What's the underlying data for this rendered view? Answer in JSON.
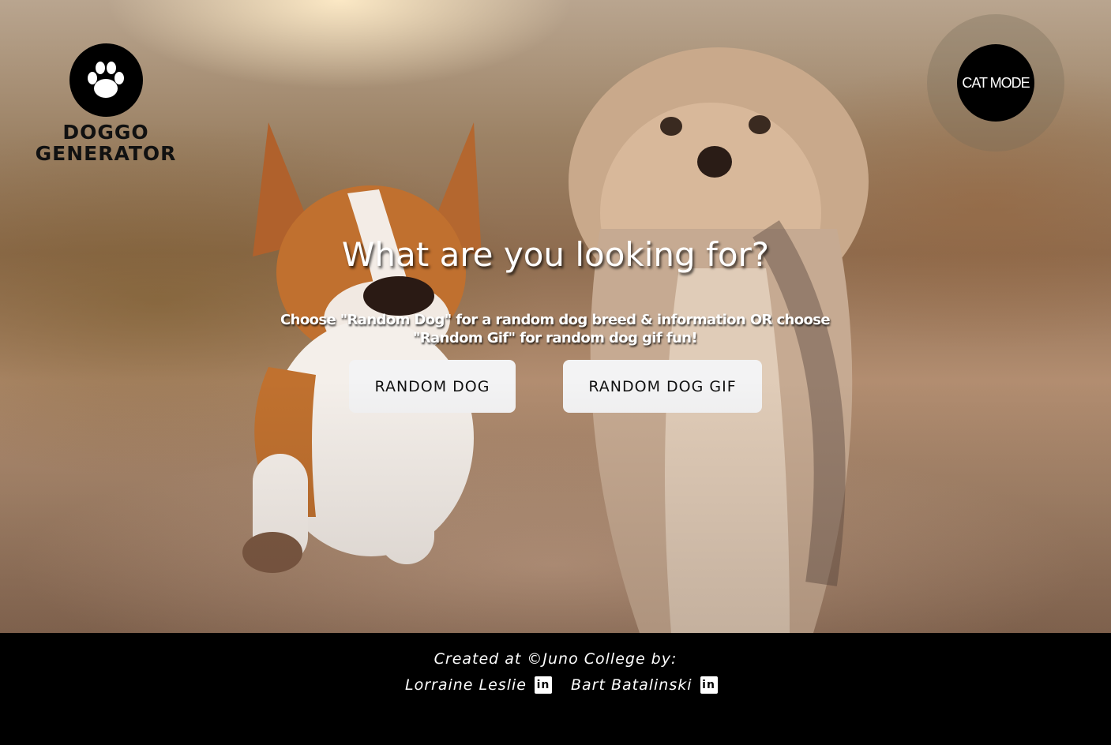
{
  "header": {
    "logo_line1": "DOGGO",
    "logo_line2": "GENERATOR",
    "logo_icon": "paw-icon",
    "cat_mode_label": "CAT MODE"
  },
  "hero": {
    "heading": "What are you looking for?",
    "subheading": "Choose \"Random Dog\" for a random dog breed & information OR choose \"Random Gif\" for random dog gif fun!",
    "buttons": {
      "random_dog": "RANDOM DOG",
      "random_gif": "RANDOM DOG GIF"
    }
  },
  "footer": {
    "credit": "Created at ©Juno College by:",
    "authors": [
      {
        "name": "Lorraine Leslie",
        "icon": "linkedin-icon"
      },
      {
        "name": "Bart Batalinski",
        "icon": "linkedin-icon"
      }
    ],
    "linkedin_glyph": "in"
  },
  "colors": {
    "button_bg": "#f3f3f4",
    "footer_bg": "#000000",
    "text_light": "#ffffff"
  }
}
